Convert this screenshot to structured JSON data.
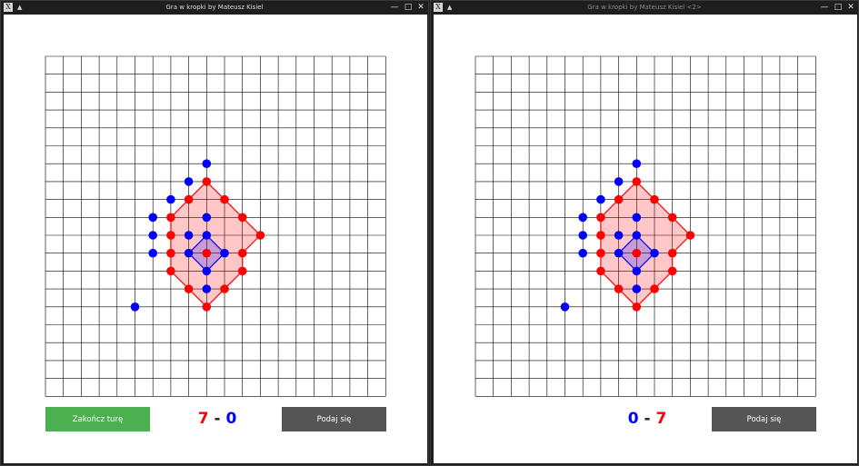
{
  "colors": {
    "red": "#ff0000",
    "blue": "#0000ff",
    "grid": "#000000",
    "end_turn_btn": "#4caf50",
    "surrender_btn": "#555555"
  },
  "windows": [
    {
      "title": "Gra w kropki by Mateusz Kisiel",
      "titlebar_icons": [
        "x-app-icon",
        "up-arrow-icon",
        "minimize-icon",
        "maximize-icon",
        "close-icon"
      ],
      "end_turn_label": "Zakończ turę",
      "surrender_label": "Podaj się",
      "score_left": "7",
      "score_sep": "-",
      "score_right": "0",
      "score_left_color": "red",
      "score_right_color": "blue"
    },
    {
      "title": "Gra w kropki by Mateusz Kisiel <2>",
      "titlebar_icons": [
        "x-app-icon",
        "up-arrow-icon",
        "minimize-icon",
        "maximize-icon",
        "close-icon"
      ],
      "surrender_label": "Podaj się",
      "score_left": "0",
      "score_sep": "-",
      "score_right": "7",
      "score_left_color": "blue",
      "score_right_color": "red"
    }
  ],
  "board": {
    "columns": 19,
    "rows": 19,
    "red_dots": [
      [
        9,
        7
      ],
      [
        8,
        8
      ],
      [
        10,
        8
      ],
      [
        7,
        9
      ],
      [
        11,
        9
      ],
      [
        12,
        10
      ],
      [
        7,
        10
      ],
      [
        11,
        11
      ],
      [
        7,
        11
      ],
      [
        9,
        11
      ],
      [
        7,
        12
      ],
      [
        11,
        12
      ],
      [
        8,
        13
      ],
      [
        10,
        13
      ],
      [
        9,
        14
      ]
    ],
    "blue_dots": [
      [
        9,
        6
      ],
      [
        8,
        7
      ],
      [
        7,
        8
      ],
      [
        6,
        9
      ],
      [
        6,
        10
      ],
      [
        6,
        11
      ],
      [
        8,
        10
      ],
      [
        9,
        9
      ],
      [
        9,
        10
      ],
      [
        8,
        11
      ],
      [
        10,
        11
      ],
      [
        9,
        12
      ],
      [
        9,
        13
      ],
      [
        5,
        14
      ]
    ],
    "red_territory": [
      [
        9,
        7
      ],
      [
        10,
        8
      ],
      [
        11,
        9
      ],
      [
        12,
        10
      ],
      [
        11,
        11
      ],
      [
        11,
        12
      ],
      [
        10,
        13
      ],
      [
        9,
        14
      ],
      [
        8,
        13
      ],
      [
        7,
        12
      ],
      [
        7,
        11
      ],
      [
        7,
        10
      ],
      [
        7,
        9
      ],
      [
        8,
        8
      ]
    ],
    "blue_territory": [
      [
        9,
        10
      ],
      [
        10,
        11
      ],
      [
        9,
        12
      ],
      [
        8,
        11
      ]
    ]
  }
}
